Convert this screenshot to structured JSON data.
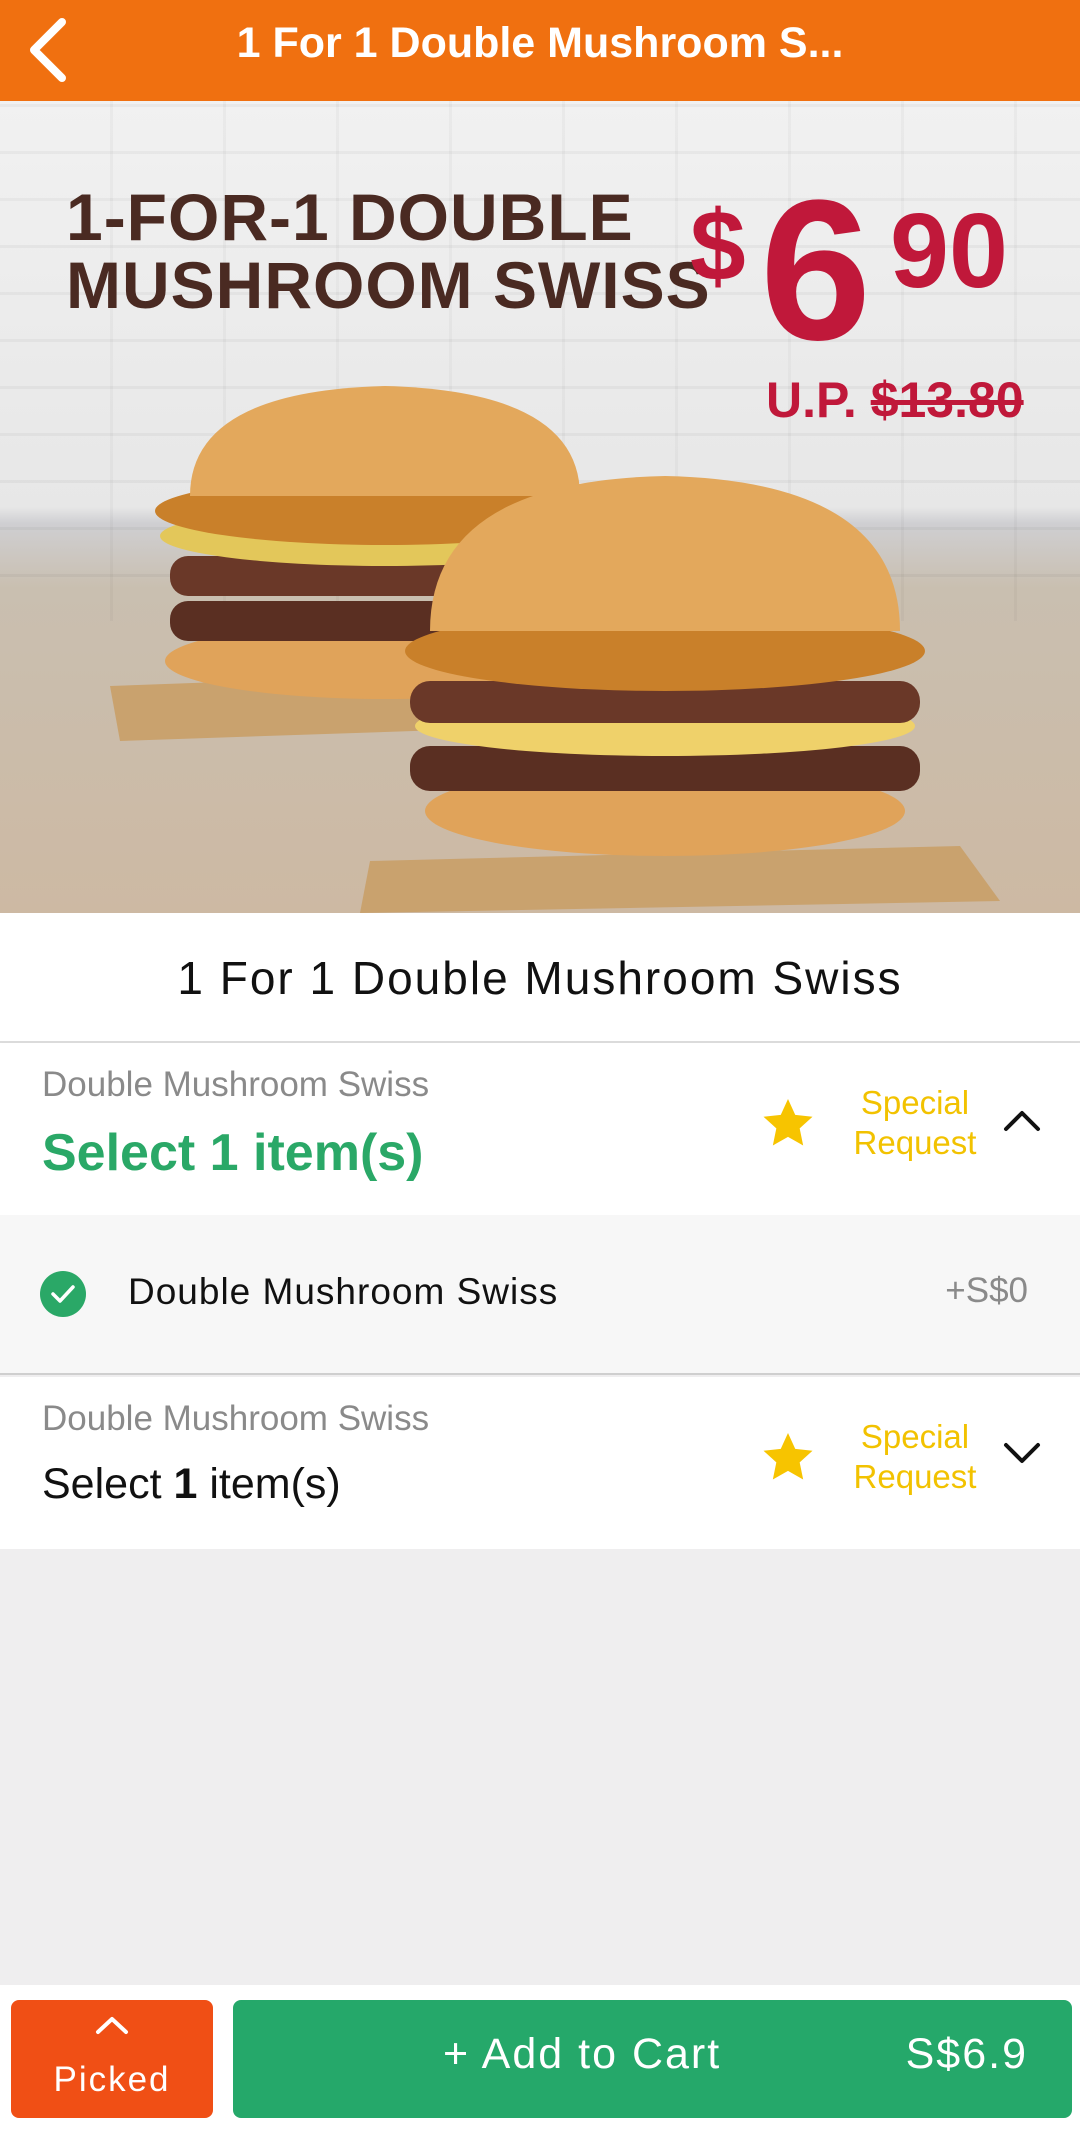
{
  "header": {
    "title": "1 For 1 Double Mushroom S..."
  },
  "hero": {
    "headline_line1": "1-FOR-1 DOUBLE",
    "headline_line2": "MUSHROOM SWISS",
    "price_dollar": "$",
    "price_main": "6",
    "price_cents": "90",
    "up_label": "U.P. ",
    "up_price": "$13.80"
  },
  "product": {
    "title": "1 For 1 Double Mushroom Swiss"
  },
  "sections": [
    {
      "name": "Double Mushroom Swiss",
      "select_text": "Select 1 item(s)",
      "special_line1": "Special",
      "special_line2": "Request",
      "expanded": true
    },
    {
      "name": "Double Mushroom Swiss",
      "select_prefix": "Select ",
      "select_count": "1",
      "select_suffix": " item(s)",
      "special_line1": "Special",
      "special_line2": "Request",
      "expanded": false
    }
  ],
  "option": {
    "label": "Double Mushroom Swiss",
    "price": "+S$0",
    "selected": true
  },
  "bottom": {
    "picked_label": "Picked",
    "cart_label": "+ Add to Cart",
    "cart_price": "S$6.9"
  },
  "colors": {
    "header": "#f07010",
    "accent_green": "#2aa867",
    "special_yellow": "#f2c200",
    "picked_orange": "#f04f15",
    "cart_green": "#25a86a"
  }
}
